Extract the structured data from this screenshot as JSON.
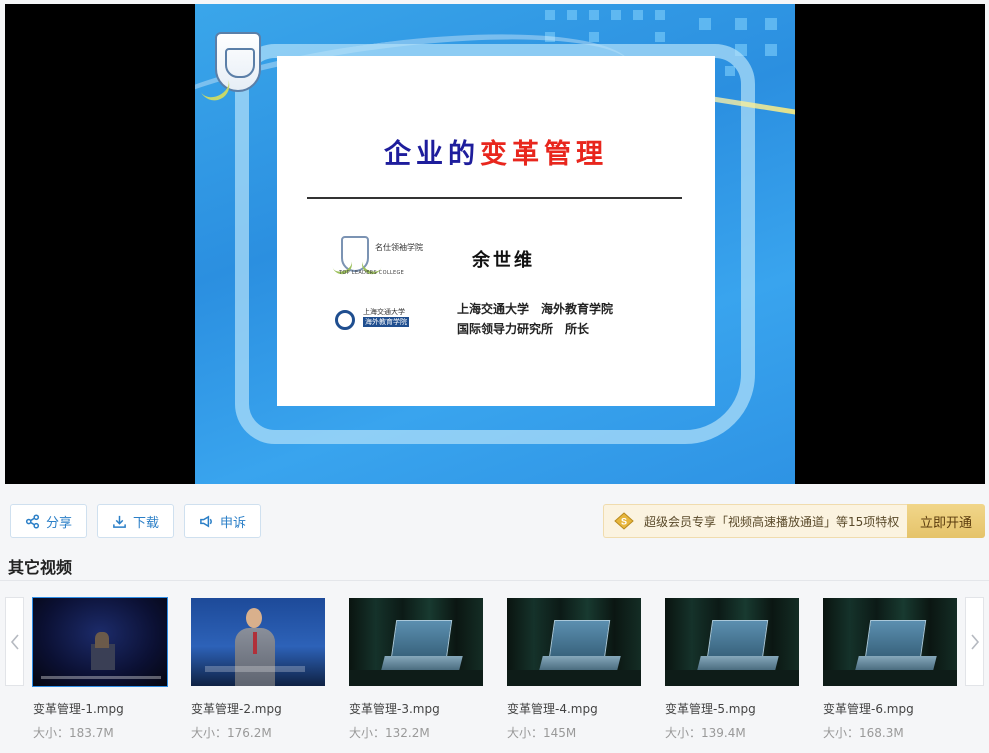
{
  "slide": {
    "title_part1": "企业的",
    "title_part2": "变革管理",
    "logo1_name": "名仕领袖学院",
    "logo1_en": "TOP LEADERS COLLEGE",
    "frame_logo_name": "名仕领袖学院",
    "author": "余世维",
    "logo2_name": "上海交通大学",
    "logo2_sub": "海外教育学院",
    "affiliation_line1": "上海交通大学　海外教育学院",
    "affiliation_line2": "国际领导力研究所　所长"
  },
  "actions": {
    "share": "分享",
    "download": "下载",
    "report": "申诉"
  },
  "vip": {
    "text": "超级会员专享「视频高速播放通道」等15项特权",
    "button": "立即开通"
  },
  "other_videos": {
    "title": "其它视频",
    "items": [
      {
        "name": "变革管理-1.mpg",
        "size": "大小：183.7M"
      },
      {
        "name": "变革管理-2.mpg",
        "size": "大小：176.2M"
      },
      {
        "name": "变革管理-3.mpg",
        "size": "大小：132.2M"
      },
      {
        "name": "变革管理-4.mpg",
        "size": "大小：145M"
      },
      {
        "name": "变革管理-5.mpg",
        "size": "大小：139.4M"
      },
      {
        "name": "变革管理-6.mpg",
        "size": "大小：168.3M"
      }
    ]
  },
  "icons": {
    "share": "share-icon",
    "download": "download-icon",
    "report": "megaphone-icon",
    "vip": "coin-icon",
    "prev": "chevron-left-icon",
    "next": "chevron-right-icon"
  },
  "colors": {
    "accent": "#2b7fc7",
    "vip_bg": "#fbf3e0",
    "vip_button": "#e5c36a"
  }
}
